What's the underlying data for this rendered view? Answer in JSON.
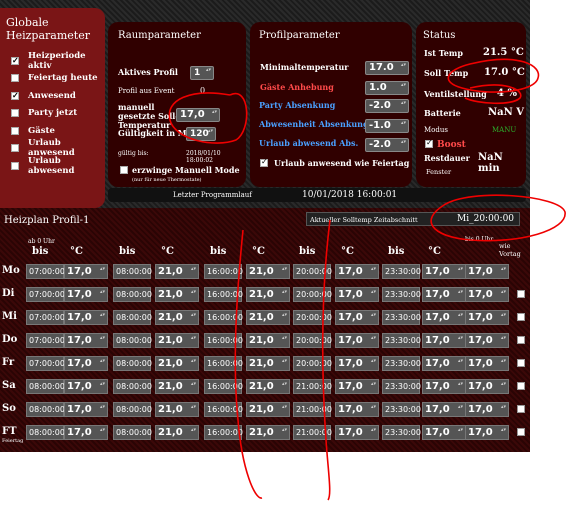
{
  "global": {
    "title": "Globale Heizparameter",
    "items": [
      {
        "label": "Heizperiode aktiv",
        "checked": true
      },
      {
        "label": "Feiertag heute",
        "checked": false
      },
      {
        "label": "Anwesend",
        "checked": true
      },
      {
        "label": "Party jetzt",
        "checked": false
      },
      {
        "label": "Gäste",
        "checked": false
      },
      {
        "label": "Urlaub anwesend",
        "checked": false
      },
      {
        "label": "Urlaub abwesend",
        "checked": false
      }
    ]
  },
  "raum": {
    "title": "Raumparameter",
    "aktives_profil_label": "Aktives Profil",
    "aktives_profil_value": "1",
    "profil_event_label": "Profil aus Event",
    "profil_event_value": "0",
    "manuell_label": "manuell gesetzte Soll-Temperatur",
    "manuell_value": "17,0",
    "gueltig_label": "Gültigkeit in Min",
    "gueltig_value": "120",
    "gueltig_bis_label": "gültig bis:",
    "gueltig_bis_value": "2018/01/10 18:00:02",
    "erzwinge_label": "erzwinge Manuell Mode",
    "erzwinge_note": "(nur für neue Thermostate)"
  },
  "profil": {
    "title": "Profilparameter",
    "min_label": "Minimaltemperatur",
    "min_value": "17.0",
    "gaeste_label": "Gäste Anhebung",
    "gaeste_value": "1.0",
    "party_label": "Party Absenkung",
    "party_value": "-2.0",
    "abw_label": "Abwesenheit Absenkung",
    "abw_value": "-1.0",
    "urlaub_label": "Urlaub abwesend Abs.",
    "urlaub_value": "-2.0",
    "feiertag_label": "Urlaub anwesend wie Feiertag"
  },
  "status": {
    "title": "Status",
    "ist_label": "Ist Temp",
    "ist_value": "21.5 °C",
    "soll_label": "Soll Temp",
    "soll_value": "17.0 °C",
    "ventil_label": "Ventilstellung",
    "ventil_value": "4 %",
    "batt_label": "Batterie",
    "batt_value": "NaN V",
    "modus_label": "Modus",
    "modus_value": "MANU",
    "boost_label": "Boost",
    "rest_label": "Restdauer",
    "rest_value": "NaN min",
    "fenster_label": "Fenster"
  },
  "bar": {
    "letzter_label": "Letzter Programmlauf",
    "letzter_value": "10/01/2018 16:00:01"
  },
  "plan": {
    "title": "Heizplan Profil-1",
    "aktuell_label": "Aktueller Solltemp Zeitabschnitt",
    "aktuell_value": "Mi_20:00:00",
    "ab_label": "ab 0 Uhr",
    "bis0_label": "bis 0 Uhr",
    "wie_vortag": "wie Vortag",
    "bis": "bis",
    "c": "°C",
    "days": [
      {
        "day": "Mo",
        "t": [
          "07:00:00",
          "08:00:00",
          "16:00:00",
          "20:00:00",
          "23:30:00"
        ],
        "v": [
          "17,0",
          "21,0",
          "21,0",
          "17,0",
          "17,0",
          "17,0"
        ]
      },
      {
        "day": "Di",
        "t": [
          "07:00:00",
          "08:00:00",
          "16:00:00",
          "20:00:00",
          "23:30:00"
        ],
        "v": [
          "17,0",
          "21,0",
          "21,0",
          "17,0",
          "17,0",
          "17,0"
        ]
      },
      {
        "day": "Mi",
        "t": [
          "07:00:00",
          "08:00:00",
          "16:00:00",
          "20:00:00",
          "23:30:00"
        ],
        "v": [
          "17,0",
          "21,0",
          "21,0",
          "17,0",
          "17,0",
          "17,0"
        ]
      },
      {
        "day": "Do",
        "t": [
          "07:00:00",
          "08:00:00",
          "16:00:00",
          "20:00:00",
          "23:30:00"
        ],
        "v": [
          "17,0",
          "21,0",
          "21,0",
          "17,0",
          "17,0",
          "17,0"
        ]
      },
      {
        "day": "Fr",
        "t": [
          "07:00:00",
          "08:00:00",
          "16:00:00",
          "20:00:00",
          "23:30:00"
        ],
        "v": [
          "17,0",
          "21,0",
          "21,0",
          "17,0",
          "17,0",
          "17,0"
        ]
      },
      {
        "day": "Sa",
        "t": [
          "08:00:00",
          "08:00:00",
          "16:00:00",
          "21:00:00",
          "23:30:00"
        ],
        "v": [
          "17,0",
          "21,0",
          "21,0",
          "17,0",
          "17,0",
          "17,0"
        ]
      },
      {
        "day": "So",
        "t": [
          "08:00:00",
          "08:00:00",
          "16:00:00",
          "21:00:00",
          "23:30:00"
        ],
        "v": [
          "17,0",
          "21,0",
          "21,0",
          "17,0",
          "17,0",
          "17,0"
        ]
      },
      {
        "day": "FT",
        "sub": "Feiertag",
        "t": [
          "08:00:00",
          "08:00:00",
          "16:00:00",
          "21:00:00",
          "23:30:00"
        ],
        "v": [
          "17,0",
          "21,0",
          "21,0",
          "17,0",
          "17,0",
          "17,0"
        ]
      }
    ]
  }
}
